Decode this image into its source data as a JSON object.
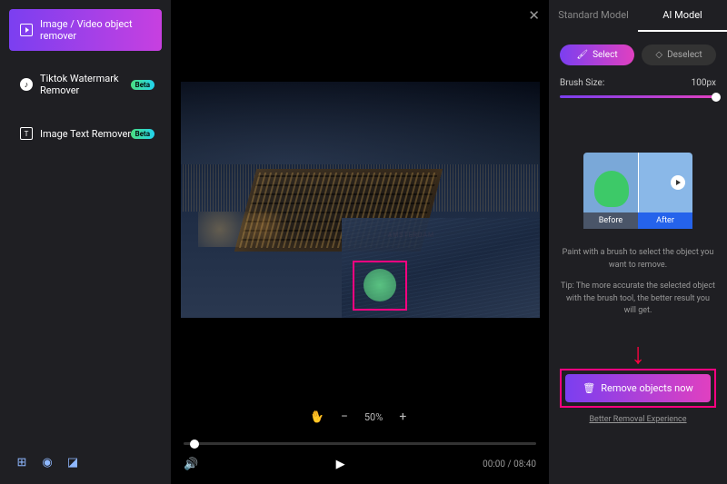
{
  "sidebar": {
    "items": [
      {
        "label": "Image / Video object remover",
        "beta": false,
        "active": true
      },
      {
        "label": "Tiktok Watermark Remover",
        "beta": true,
        "active": false
      },
      {
        "label": "Image Text Remover",
        "beta": true,
        "active": false
      }
    ],
    "beta_label": "Beta"
  },
  "main": {
    "zoom": {
      "value": "50%",
      "minus": "−",
      "plus": "+"
    },
    "time": {
      "current": "00:00",
      "total": "08:40"
    }
  },
  "panel": {
    "tabs": {
      "standard": "Standard Model",
      "ai": "AI Model"
    },
    "modes": {
      "select": "Select",
      "deselect": "Deselect"
    },
    "brush": {
      "label": "Brush Size:",
      "value": "100px"
    },
    "preview": {
      "before": "Before",
      "after": "After"
    },
    "hint1": "Paint with a brush to select the object you want to remove.",
    "hint2": "Tip: The more accurate the selected object with the brush tool, the better result you will get.",
    "cta": "Remove objects now",
    "link": "Better Removal Experience"
  }
}
